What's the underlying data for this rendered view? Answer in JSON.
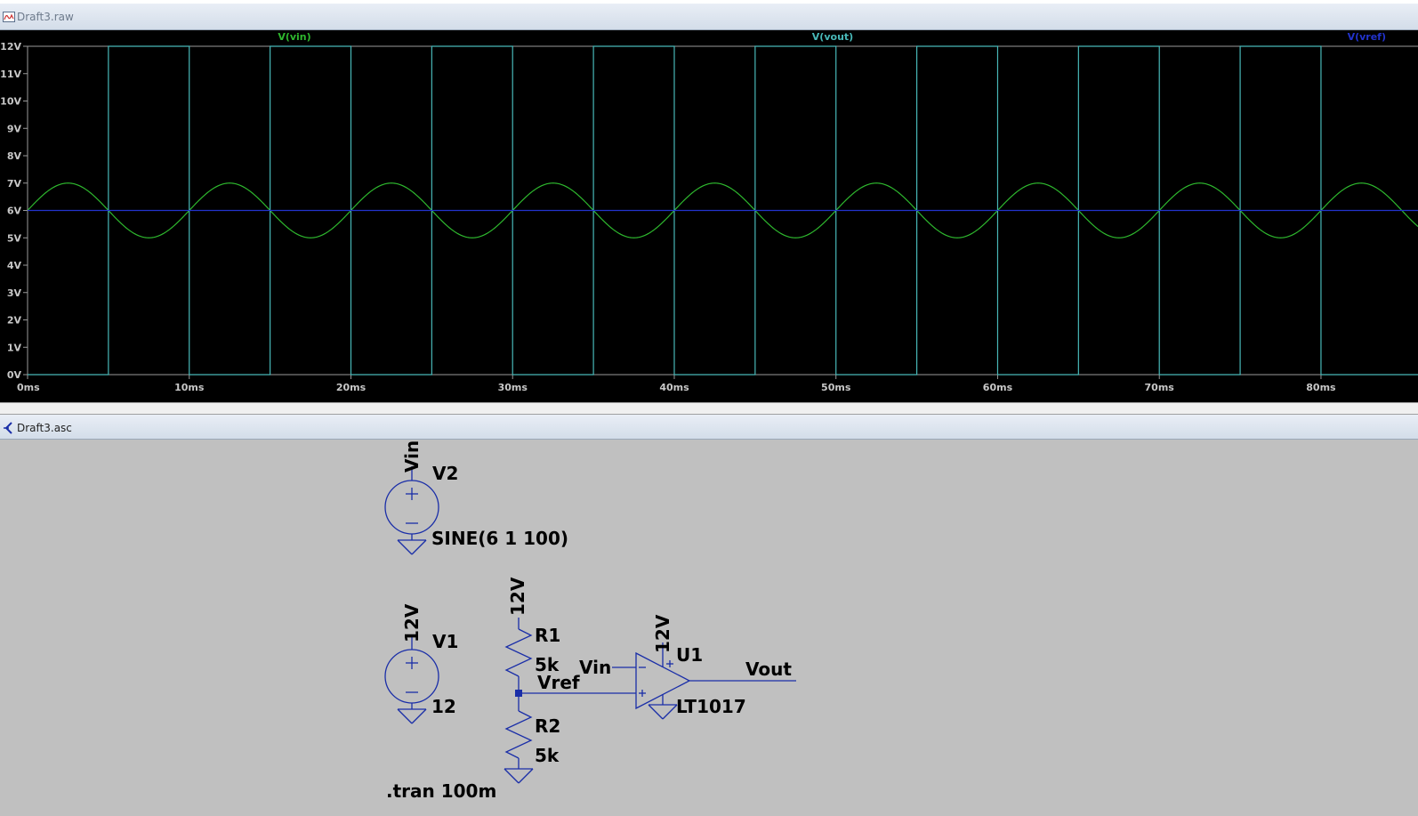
{
  "waveform_window": {
    "title": "Draft3.raw"
  },
  "schematic_window": {
    "title": "Draft3.asc"
  },
  "colors": {
    "plot_bg": "#000000",
    "axis": "#9a9a9a",
    "axis_text": "#c8c8c8",
    "vin": "#2eb82e",
    "vout": "#48b8b8",
    "vref": "#2233cc",
    "schematic_bg": "#c0c0c0",
    "wire": "#1a2ea8",
    "label": "#000000"
  },
  "chart_data": {
    "type": "line",
    "x_unit": "ms",
    "x_range": [
      0,
      86
    ],
    "y_range": [
      0,
      12
    ],
    "y_ticks": [
      0,
      1,
      2,
      3,
      4,
      5,
      6,
      7,
      8,
      9,
      10,
      11,
      12
    ],
    "y_tick_labels": [
      "0V",
      "1V",
      "2V",
      "3V",
      "4V",
      "5V",
      "6V",
      "7V",
      "8V",
      "9V",
      "10V",
      "11V",
      "12V"
    ],
    "x_ticks": [
      0,
      10,
      20,
      30,
      40,
      50,
      60,
      70,
      80
    ],
    "x_tick_labels": [
      "0ms",
      "10ms",
      "20ms",
      "30ms",
      "40ms",
      "50ms",
      "60ms",
      "70ms",
      "80ms"
    ],
    "series": [
      {
        "name": "V(vin)",
        "color": "#2eb82e",
        "kind": "sine",
        "offset_v": 6,
        "amplitude_v": 1,
        "frequency_hz": 100
      },
      {
        "name": "V(vout)",
        "color": "#48b8b8",
        "kind": "square",
        "low_v": 0,
        "high_v": 12,
        "transitions_ms": [
          5,
          10,
          15,
          20,
          25,
          30,
          35,
          40,
          45,
          50,
          55,
          60,
          65,
          70,
          75,
          80
        ],
        "initial_v": 0
      },
      {
        "name": "V(vref)",
        "color": "#2233cc",
        "kind": "constant",
        "value_v": 6
      }
    ]
  },
  "schematic": {
    "v2": {
      "name": "V2",
      "node": "Vin",
      "value": "SINE(6 1 100)"
    },
    "v1": {
      "name": "V1",
      "node": "12V",
      "value": "12"
    },
    "r1": {
      "name": "R1",
      "value": "5k",
      "node": "12V"
    },
    "r2": {
      "name": "R2",
      "value": "5k"
    },
    "vref_label": "Vref",
    "u1": {
      "name": "U1",
      "part": "LT1017",
      "supply": "12V",
      "in_label": "Vin",
      "out_label": "Vout"
    },
    "directive": ".tran 100m"
  }
}
